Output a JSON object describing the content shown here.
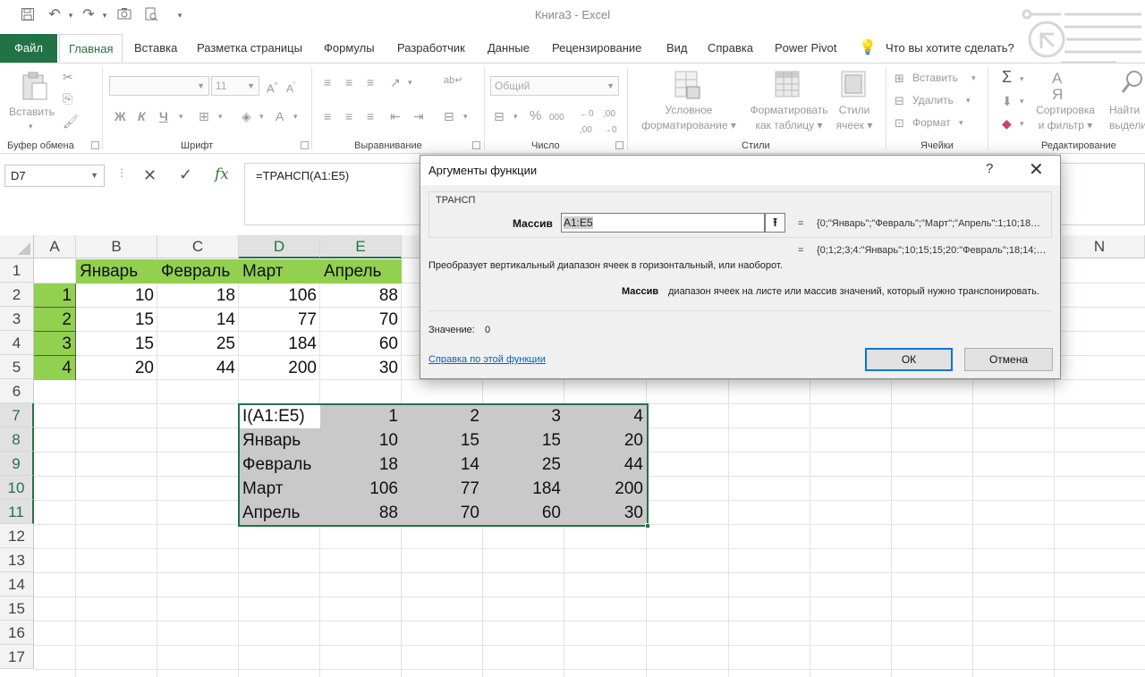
{
  "window": {
    "title": "Книга3  -  Excel"
  },
  "tabs": [
    {
      "label": "Файл"
    },
    {
      "label": "Главная"
    },
    {
      "label": "Вставка"
    },
    {
      "label": "Разметка страницы"
    },
    {
      "label": "Формулы"
    },
    {
      "label": "Разработчик"
    },
    {
      "label": "Данные"
    },
    {
      "label": "Рецензирование"
    },
    {
      "label": "Вид"
    },
    {
      "label": "Справка"
    },
    {
      "label": "Power Pivot"
    },
    {
      "label": "Что вы хотите сделать?"
    }
  ],
  "ribbon": {
    "groups": {
      "clipboard": "Буфер обмена",
      "font": "Шрифт",
      "alignment": "Выравнивание",
      "number": "Число",
      "styles": "Стили",
      "cells": "Ячейки",
      "editing": "Редактирование"
    },
    "paste": "Вставить",
    "font_size": "11",
    "number_format": "Общий",
    "bold": "Ж",
    "italic": "К",
    "underline": "Ч",
    "cond_format": [
      "Условное",
      "форматирование ▾"
    ],
    "format_table": [
      "Форматировать",
      "как таблицу ▾"
    ],
    "cell_styles": [
      "Стили",
      "ячеек ▾"
    ],
    "insert": "Вставить",
    "delete": "Удалить",
    "format": "Формат",
    "sort": [
      "Сортировка",
      "и фильтр ▾"
    ],
    "find": [
      "Найти",
      "выдели"
    ]
  },
  "formula_bar": {
    "name_box": "D7",
    "formula": "=ТРАНСП(A1:E5)"
  },
  "columns": [
    "A",
    "B",
    "C",
    "D",
    "E",
    "N"
  ],
  "rows": [
    "1",
    "2",
    "3",
    "4",
    "5",
    "6",
    "7",
    "8",
    "9",
    "10",
    "11",
    "12",
    "13",
    "14",
    "15",
    "16",
    "17"
  ],
  "sheet": {
    "source_header": [
      "Январь",
      "Февраль",
      "Март",
      "Апрель"
    ],
    "source_rows": [
      [
        "1",
        "10",
        "18",
        "106",
        "88"
      ],
      [
        "2",
        "15",
        "14",
        "77",
        "70"
      ],
      [
        "3",
        "15",
        "25",
        "184",
        "60"
      ],
      [
        "4",
        "20",
        "44",
        "200",
        "30"
      ]
    ],
    "result_rows": [
      [
        "I(A1:E5)",
        "1",
        "2",
        "3",
        "4"
      ],
      [
        "Январь",
        "10",
        "15",
        "15",
        "20"
      ],
      [
        "Февраль",
        "18",
        "14",
        "25",
        "44"
      ],
      [
        "Март",
        "106",
        "77",
        "184",
        "200"
      ],
      [
        "Апрель",
        "88",
        "70",
        "60",
        "30"
      ]
    ]
  },
  "dialog": {
    "title": "Аргументы функции",
    "help": "?",
    "close": "✕",
    "function_name": "ТРАНСП",
    "arg_label": "Массив",
    "arg_value": "A1:E5",
    "arg_eval": "{0;\"Январь\";\"Февраль\";\"Март\";\"Апрель\":1;10;18…",
    "result_eval": "{0;1;2;3;4:\"Январь\";10;15;15;20:\"Февраль\";18;14;…",
    "description": "Преобразует вертикальный диапазон ячеек в горизонтальный, или наоборот.",
    "arg_help_label": "Массив",
    "arg_help": "диапазон ячеек на листе или массив значений, который нужно транспонировать.",
    "value_label": "Значение:",
    "value": "0",
    "link": "Справка по этой функции",
    "ok": "ОК",
    "cancel": "Отмена"
  }
}
